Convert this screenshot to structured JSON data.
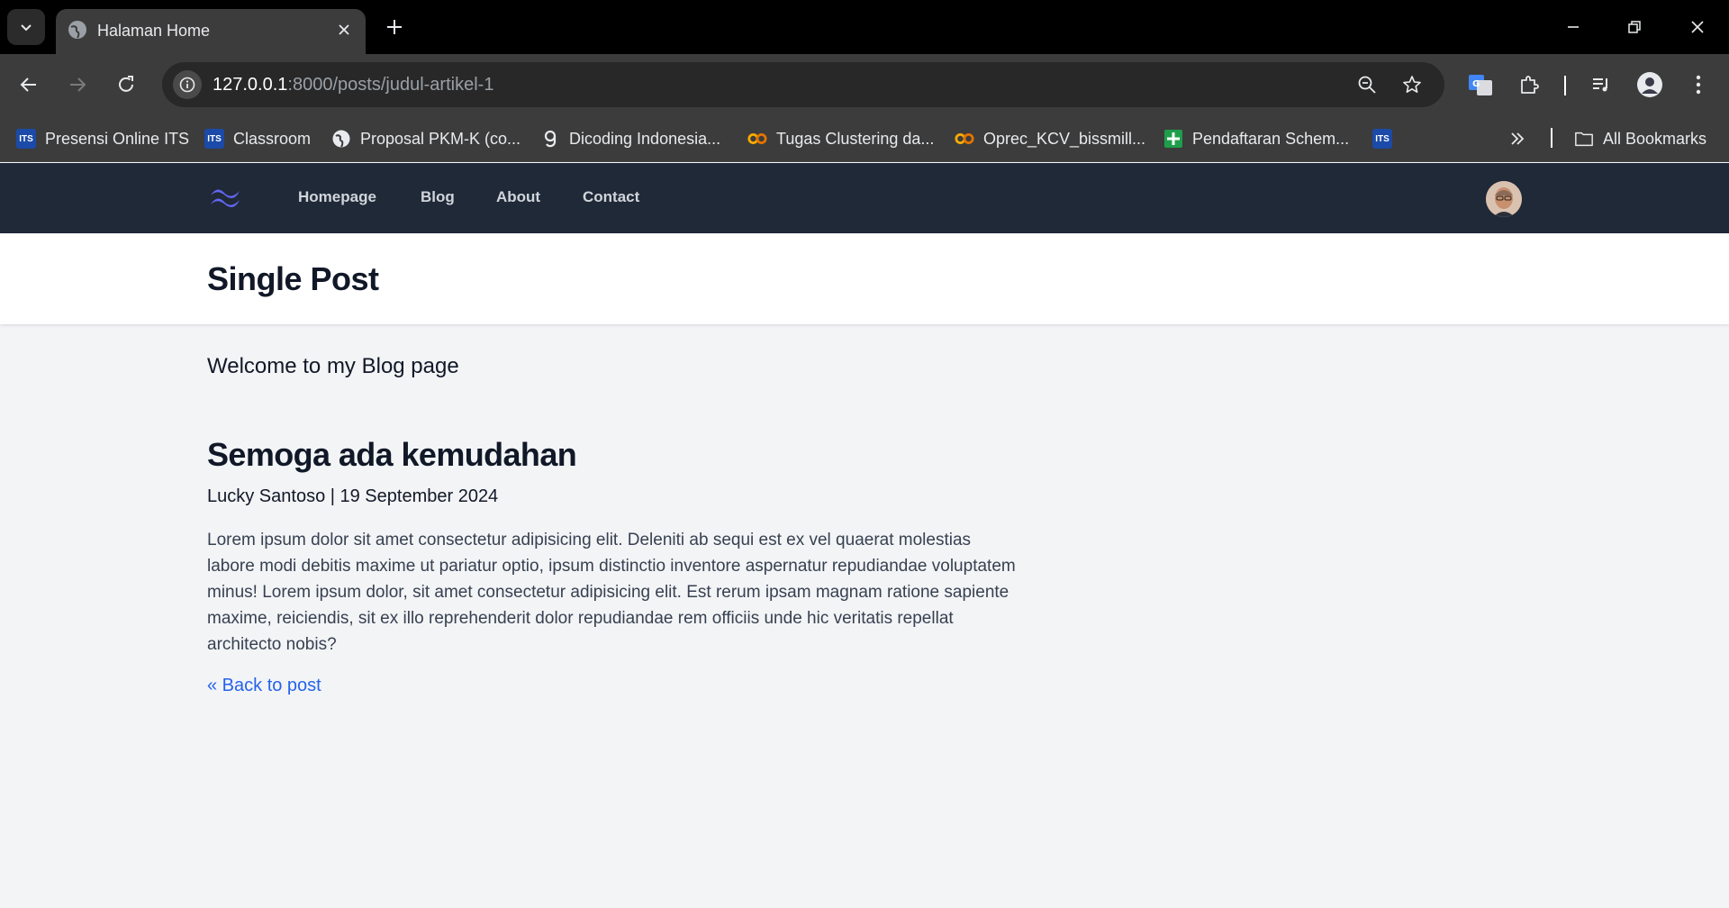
{
  "browser": {
    "tab_title": "Halaman Home",
    "url_host": "127.0.0.1",
    "url_path": ":8000/posts/judul-artikel-1",
    "bookmarks": [
      {
        "label": "Presensi Online ITS",
        "icon": "its-icon"
      },
      {
        "label": "Classroom",
        "icon": "its-icon"
      },
      {
        "label": "Proposal PKM-K (co...",
        "icon": "globe-icon"
      },
      {
        "label": "Dicoding Indonesia...",
        "icon": "dicoding-icon"
      },
      {
        "label": "Tugas Clustering da...",
        "icon": "colab-icon"
      },
      {
        "label": "Oprec_KCV_bissmill...",
        "icon": "colab-icon"
      },
      {
        "label": "Pendaftaran Schem...",
        "icon": "sheets-plus-icon"
      }
    ],
    "all_bookmarks_label": "All Bookmarks"
  },
  "nav": {
    "links": [
      "Homepage",
      "Blog",
      "About",
      "Contact"
    ]
  },
  "header": {
    "title": "Single Post"
  },
  "main": {
    "welcome": "Welcome to my Blog page",
    "post": {
      "title": "Semoga ada kemudahan",
      "meta": "Lucky Santoso | 19 September 2024",
      "body": "Lorem ipsum dolor sit amet consectetur adipisicing elit. Deleniti ab sequi est ex vel quaerat molestias labore modi debitis maxime ut pariatur optio, ipsum distinctio inventore aspernatur repudiandae voluptatem minus! Lorem ipsum dolor, sit amet consectetur adipisicing elit. Est rerum ipsam magnam ratione sapiente maxime, reiciendis, sit ex illo reprehenderit dolor repudiandae rem officiis unde hic veritatis repellat architecto nobis?",
      "back_link": "« Back to post"
    }
  },
  "colors": {
    "nav_bg": "#1f2937",
    "link": "#2563eb",
    "logo": "#6366f1"
  }
}
